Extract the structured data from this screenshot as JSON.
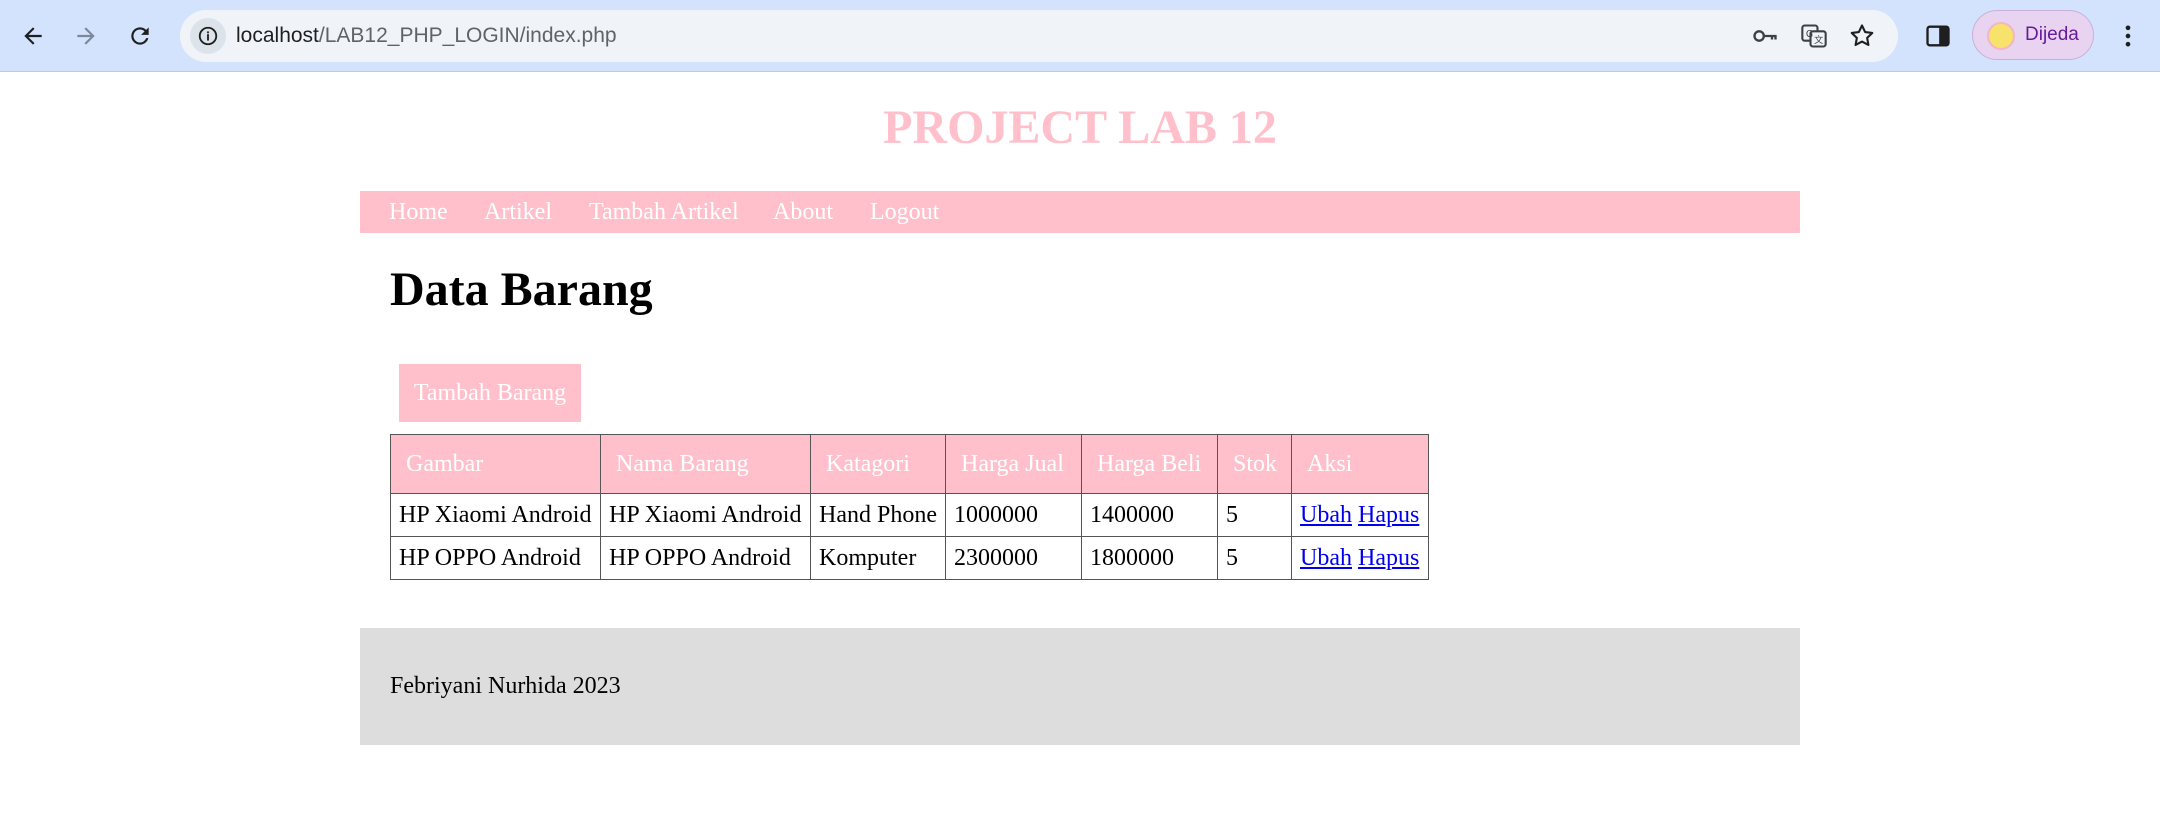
{
  "browser": {
    "url_host": "localhost",
    "url_path": "/LAB12_PHP_LOGIN/index.php",
    "profile_name": "Dijeda"
  },
  "site": {
    "title": "PROJECT LAB 12",
    "nav": [
      "Home",
      "Artikel",
      "Tambah Artikel",
      "About",
      "Logout"
    ]
  },
  "main": {
    "heading": "Data Barang",
    "add_button": "Tambah Barang",
    "table": {
      "headers": [
        "Gambar",
        "Nama Barang",
        "Katagori",
        "Harga Jual",
        "Harga Beli",
        "Stok",
        "Aksi"
      ],
      "rows": [
        {
          "gambar": "HP Xiaomi Android",
          "nama": "HP Xiaomi Android",
          "kategori": "Hand Phone",
          "harga_jual": "1000000",
          "harga_beli": "1400000",
          "stok": "5",
          "ubah": "Ubah",
          "hapus": "Hapus"
        },
        {
          "gambar": "HP OPPO Android",
          "nama": "HP OPPO Android",
          "kategori": "Komputer",
          "harga_jual": "2300000",
          "harga_beli": "1800000",
          "stok": "5",
          "ubah": "Ubah",
          "hapus": "Hapus"
        }
      ]
    }
  },
  "footer": {
    "text": "Febriyani Nurhida 2023"
  },
  "colors": {
    "accent_pink": "#ffc0cb",
    "footer_bg": "#dddddd",
    "chrome_bg": "#d3e3fd"
  }
}
